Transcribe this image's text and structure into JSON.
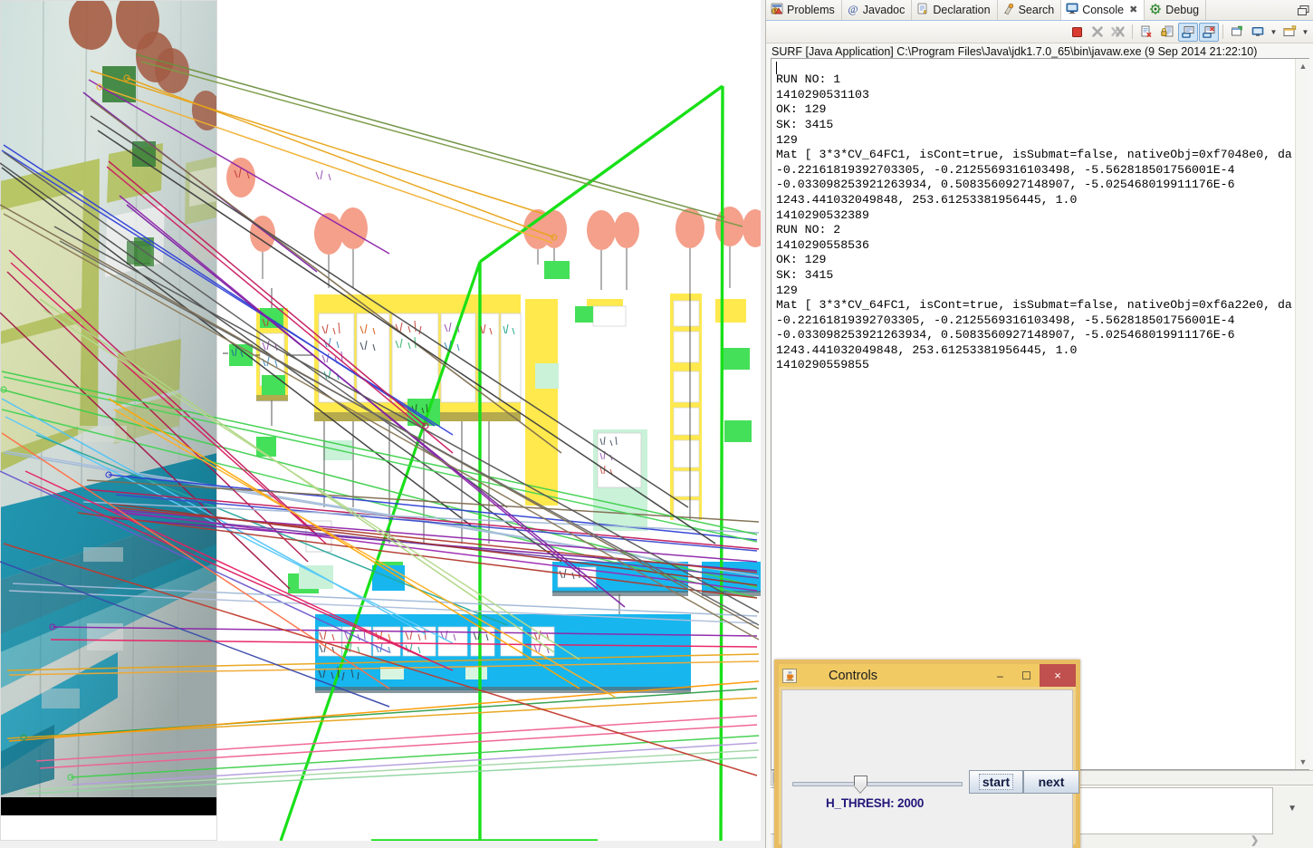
{
  "eclipse": {
    "tabs": [
      {
        "label": "Problems",
        "icon": "problems-icon",
        "active": false,
        "closable": false
      },
      {
        "label": "Javadoc",
        "icon": "javadoc-icon",
        "active": false,
        "closable": false
      },
      {
        "label": "Declaration",
        "icon": "declaration-icon",
        "active": false,
        "closable": false
      },
      {
        "label": "Search",
        "icon": "search-icon",
        "active": false,
        "closable": false
      },
      {
        "label": "Console",
        "icon": "console-icon",
        "active": true,
        "closable": true
      },
      {
        "label": "Debug",
        "icon": "debug-icon",
        "active": false,
        "closable": false
      }
    ],
    "restore_icon": "restore-view-icon",
    "toolbar": [
      {
        "name": "terminate-button",
        "icon": "stop-square-icon",
        "enabled": true,
        "toggled": false
      },
      {
        "name": "remove-launch-button",
        "icon": "remove-x-icon",
        "enabled": false,
        "toggled": false
      },
      {
        "name": "remove-all-terminated-button",
        "icon": "remove-all-x-icon",
        "enabled": false,
        "toggled": false
      },
      {
        "name": "clear-console-button",
        "icon": "clear-console-icon",
        "enabled": true,
        "toggled": false
      },
      {
        "name": "scroll-lock-button",
        "icon": "scroll-lock-icon",
        "enabled": true,
        "toggled": false
      },
      {
        "name": "show-console-on-output-button",
        "icon": "show-console-stdout-icon",
        "enabled": true,
        "toggled": true
      },
      {
        "name": "show-console-on-error-button",
        "icon": "show-console-stderr-icon",
        "enabled": true,
        "toggled": true
      },
      {
        "name": "pin-console-button",
        "icon": "pin-console-icon",
        "enabled": true,
        "toggled": false
      },
      {
        "name": "display-selected-console-button",
        "icon": "display-console-icon",
        "enabled": true,
        "toggled": false
      },
      {
        "name": "open-console-button",
        "icon": "open-console-icon",
        "enabled": true,
        "toggled": false
      }
    ],
    "launch_label": "SURF [Java Application] C:\\Program Files\\Java\\jdk1.7.0_65\\bin\\javaw.exe (9 Sep 2014 21:22:10)",
    "console_output": "RUN NO: 1\n1410290531103\nOK: 129\nSK: 3415\n129\nMat [ 3*3*CV_64FC1, isCont=true, isSubmat=false, nativeObj=0xf7048e0, da\n-0.22161819392703305, -0.2125569316103498, -5.562818501756001E-4\n-0.033098253921263934, 0.5083560927148907, -5.025468019911176E-6\n1243.441032049848, 253.61253381956445, 1.0\n1410290532389\nRUN NO: 2\n1410290558536\nOK: 129\nSK: 3415\n129\nMat [ 3*3*CV_64FC1, isCont=true, isSubmat=false, nativeObj=0xf6a22e0, da\n-0.22161819392703305, -0.2125569316103498, -5.562818501756001E-4\n-0.033098253921263934, 0.5083560927148907, -5.025468019911176E-6\n1243.441032049848, 253.61253381956445, 1.0\n1410290559855",
    "scrollbars": {
      "vertical_up": "⌃",
      "vertical_down": "⌄",
      "horizontal_right": "❯"
    }
  },
  "controls_dialog": {
    "title": "Controls",
    "app_icon": "java-coffee-cup-icon",
    "minimize_label": "–",
    "maximize_label": "☐",
    "close_label": "×",
    "slider": {
      "name": "h-thresh-slider",
      "value": 2000,
      "label": "H_THRESH: 2000",
      "position_pct": 38
    },
    "buttons": [
      {
        "name": "start-button",
        "label": "start",
        "focused": true
      },
      {
        "name": "next-button",
        "label": "next",
        "focused": false
      }
    ]
  },
  "match_view": {
    "name": "surf-match-result-image",
    "description": "OpenCV SURF feature match visualization: photograph of a wall-mounted diagram poster (left half) matched against a rendered vector diagram (right half), with colored match lines and a green homography quadrilateral.",
    "photo_colors": {
      "wall": "#d8e4e0",
      "teal_band": "#1596b4",
      "olive_panel": "#b5c45a",
      "salmon_oval": "#b9745a",
      "green_node": "#4a8f3e",
      "black_border": "#000000"
    },
    "diagram_colors": {
      "background": "#ffffff",
      "yellow_group": "#ffe94d",
      "cyan_group": "#17b6ee",
      "green_node": "#45e05a",
      "salmon_oval": "#f4a08b",
      "mint_node": "#c9f2d8",
      "homography": "#18e018"
    },
    "match_line_colors": [
      "#00a651",
      "#ffa500",
      "#2e3fd4",
      "#c2185b",
      "#8e24aa",
      "#7d6b4f",
      "#9fb8d6",
      "#f06292",
      "#4fc3f7",
      "#b39ddb",
      "#a5d6a7",
      "#ff7043",
      "#6d8f3f",
      "#d81b60",
      "#3949ab",
      "#26a69a",
      "#e91e63",
      "#aed581"
    ]
  }
}
